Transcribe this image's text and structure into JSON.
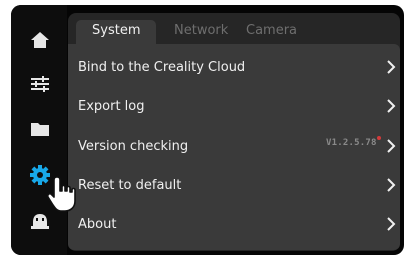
{
  "sidebar": {
    "items": [
      {
        "name": "home-icon"
      },
      {
        "name": "sliders-icon"
      },
      {
        "name": "folder-icon"
      },
      {
        "name": "gear-icon",
        "active": true
      },
      {
        "name": "robot-icon"
      }
    ]
  },
  "tabs": [
    {
      "label": "System",
      "active": true
    },
    {
      "label": "Network",
      "active": false
    },
    {
      "label": "Camera",
      "active": false
    }
  ],
  "settings": {
    "items": [
      {
        "label": "Bind to the Creality Cloud"
      },
      {
        "label": "Export log"
      },
      {
        "label": "Version checking",
        "value": "V1.2.5.78"
      },
      {
        "label": "Reset to default"
      },
      {
        "label": "About"
      }
    ]
  },
  "colors": {
    "accent": "#18a8e8",
    "background": "#050505",
    "panel": "#262626",
    "list": "#3a3a3a",
    "text": "#f0f0f0",
    "tab_inactive": "#6e6e6e",
    "update_dot": "#d43a3a"
  }
}
